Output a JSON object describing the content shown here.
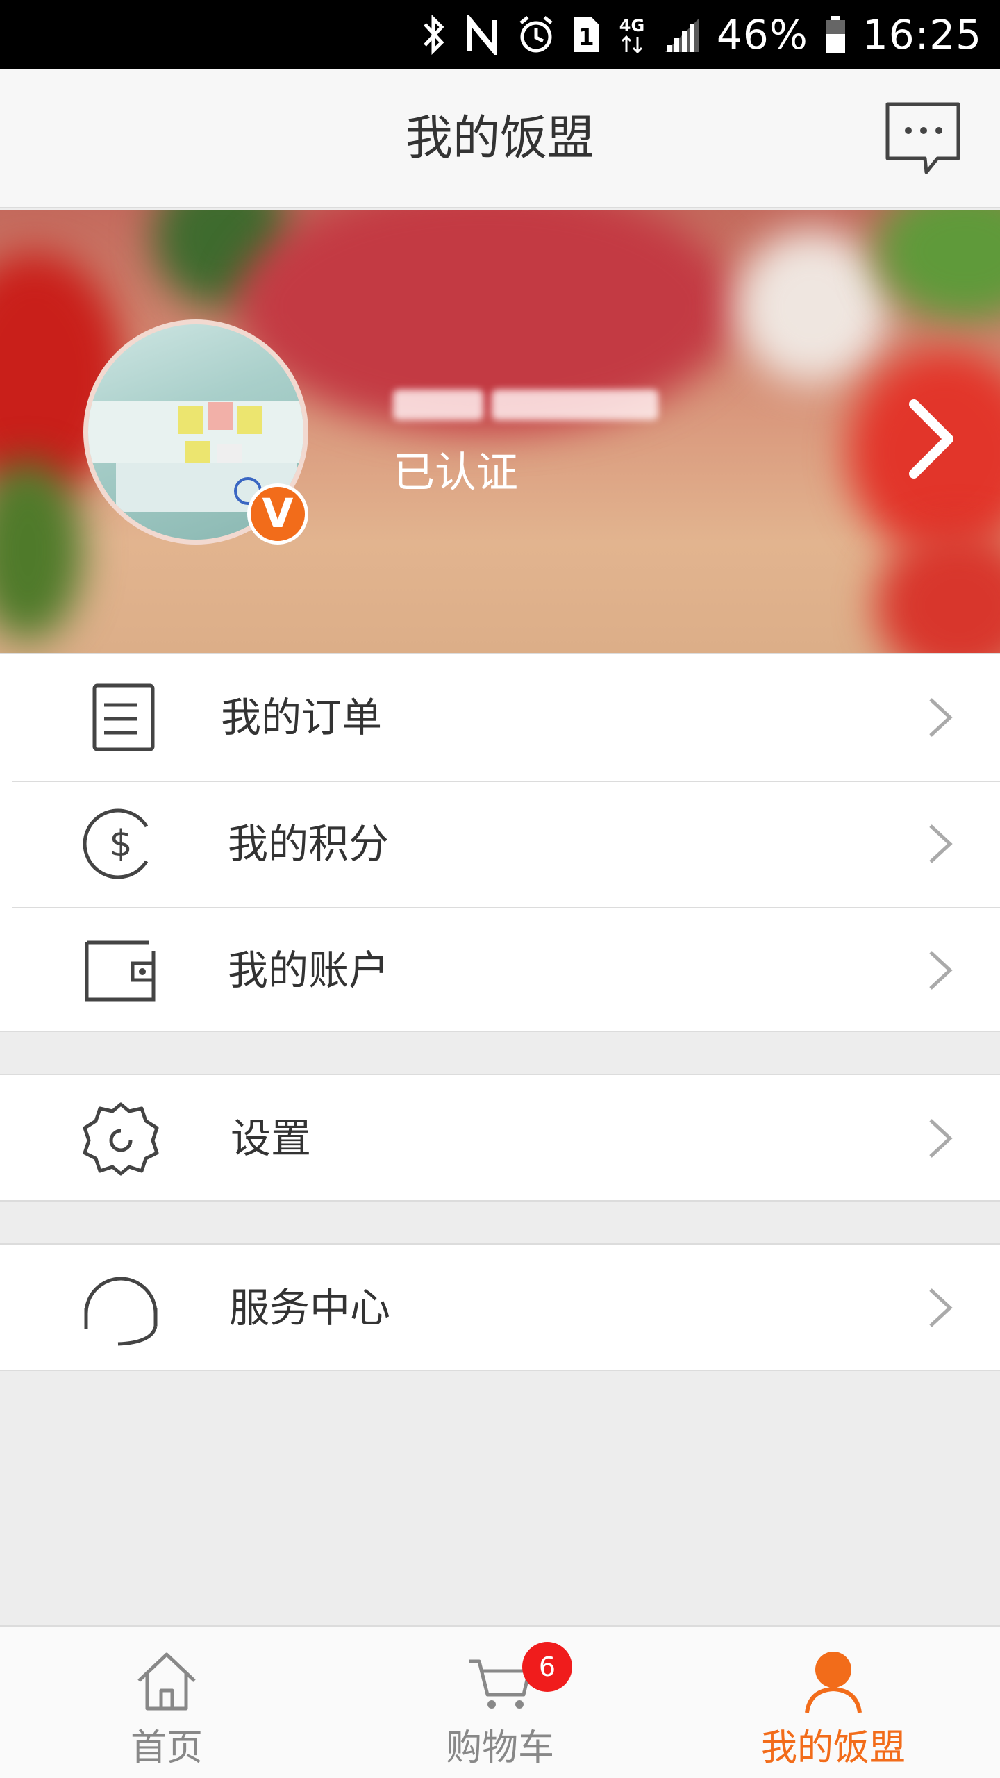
{
  "status_bar": {
    "battery": "46%",
    "time": "16:25",
    "network": "4G",
    "sim": "1",
    "icons": [
      "bluetooth-icon",
      "nfc-icon",
      "alarm-icon",
      "sim-icon",
      "network-icon",
      "signal-icon",
      "battery-icon"
    ]
  },
  "header": {
    "title": "我的饭盟",
    "message_icon": "chat-bubble-icon"
  },
  "profile": {
    "status": "已认证",
    "verified_badge": "V"
  },
  "menu_group_1": [
    {
      "label": "我的订单",
      "icon": "order-list-icon"
    },
    {
      "label": "我的积分",
      "icon": "dollar-coin-icon"
    },
    {
      "label": "我的账户",
      "icon": "wallet-icon"
    }
  ],
  "menu_group_2": [
    {
      "label": "设置",
      "icon": "gear-icon"
    }
  ],
  "menu_group_3": [
    {
      "label": "服务中心",
      "icon": "headset-icon"
    }
  ],
  "tabbar": {
    "home_label": "首页",
    "cart_label": "购物车",
    "cart_badge": "6",
    "mine_label": "我的饭盟",
    "active_tab": "我的饭盟"
  },
  "colors": {
    "accent": "#f26c1a",
    "badge": "#f01c1c",
    "text": "#333333",
    "background": "#ededed"
  }
}
